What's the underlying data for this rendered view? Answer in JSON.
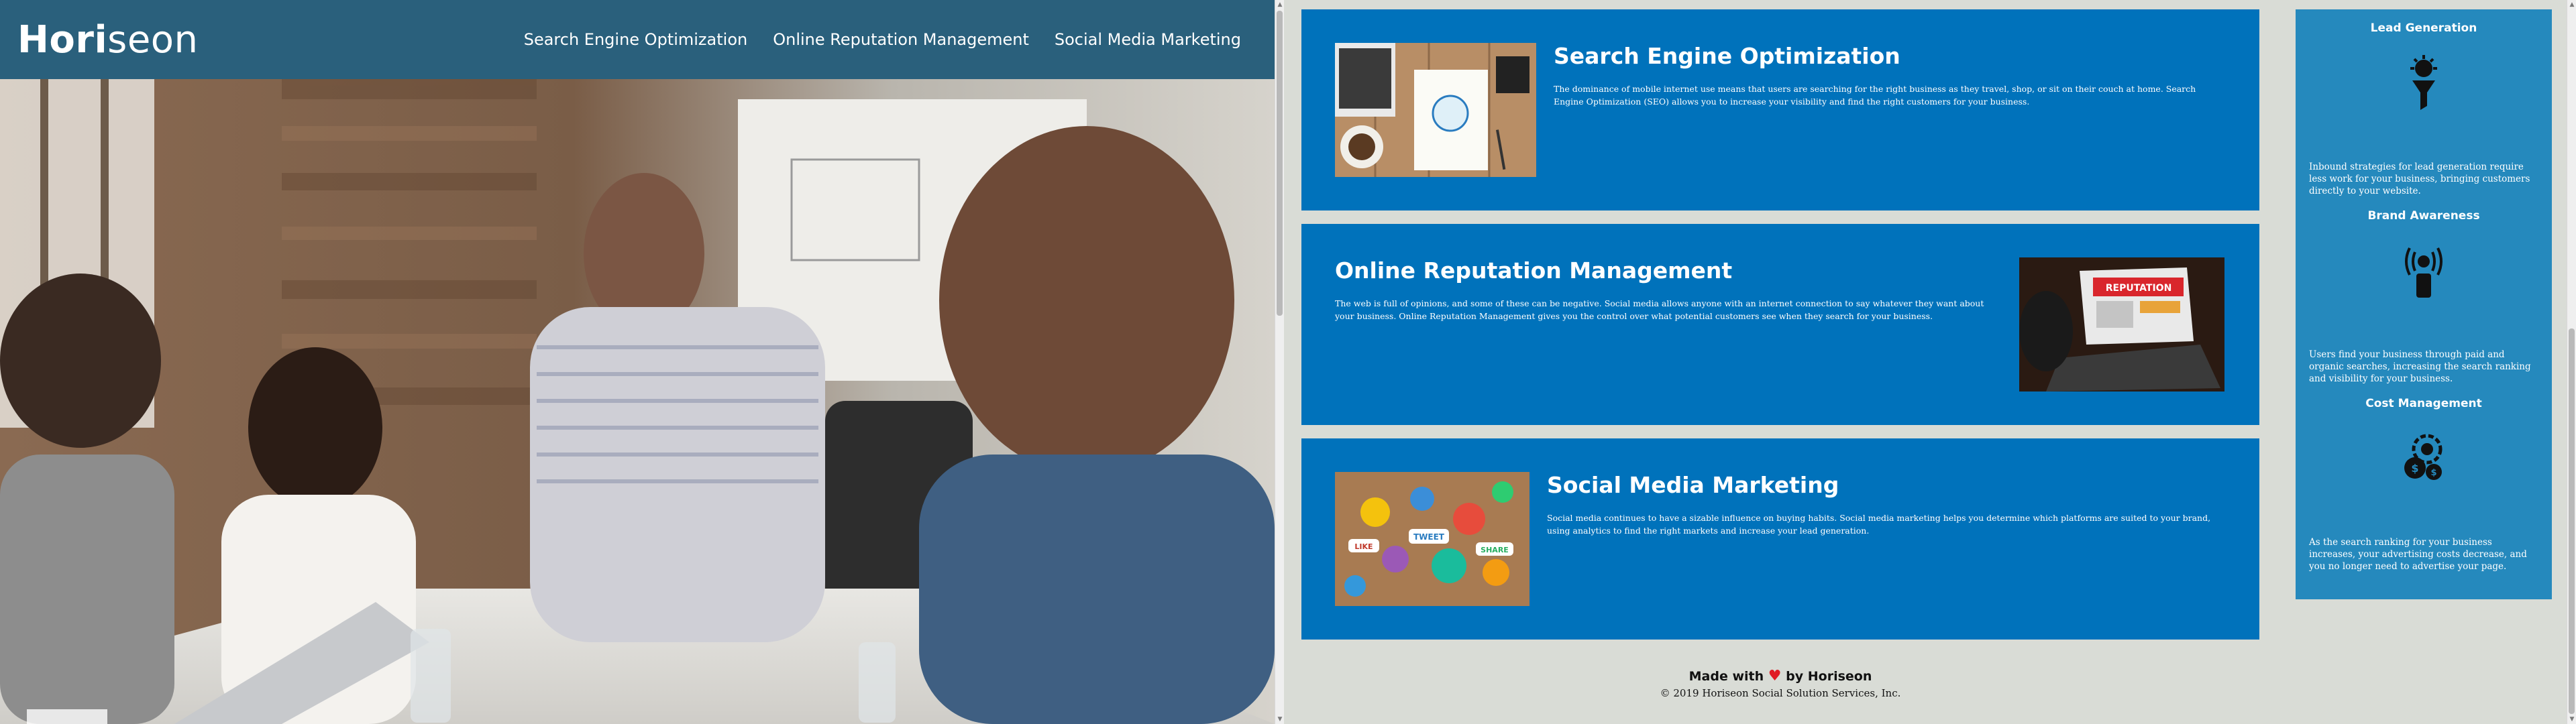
{
  "header": {
    "logo_main": "Hori",
    "logo_accent": "seon",
    "nav": [
      {
        "label": "Search Engine Optimization"
      },
      {
        "label": "Online Reputation Management"
      },
      {
        "label": "Social Media Marketing"
      }
    ]
  },
  "sections": [
    {
      "title": "Search Engine Optimization",
      "body": "The dominance of mobile internet use means that users are searching for the right business as they travel, shop, or sit on their couch at home. Search Engine Optimization (SEO) allows you to increase your visibility and find the right customers for your business.",
      "image_icon": "seo-workspace-image"
    },
    {
      "title": "Online Reputation Management",
      "body": "The web is full of opinions, and some of these can be negative. Social media allows anyone with an internet connection to say whatever they want about your business. Online Reputation Management gives you the control over what potential customers see when they search for your business.",
      "image_icon": "reputation-laptop-image",
      "image_text": "REPUTATION"
    },
    {
      "title": "Social Media Marketing",
      "body": "Social media continues to have a sizable influence on buying habits. Social media marketing helps you determine which platforms are suited to your brand, using analytics to find the right markets and increase your lead generation.",
      "image_icon": "social-media-collage-image",
      "image_labels": [
        "TWEET",
        "LIKE",
        "SHARE"
      ]
    }
  ],
  "benefits": [
    {
      "title": "Lead Generation",
      "body": "Inbound strategies for lead generation require less work for your business, bringing customers directly to your website.",
      "icon": "lead-generation-icon"
    },
    {
      "title": "Brand Awareness",
      "body": "Users find your business through paid and organic searches, increasing the search ranking and visibility for your business.",
      "icon": "brand-awareness-icon"
    },
    {
      "title": "Cost Management",
      "body": "As the search ranking for your business increases, your advertising costs decrease, and you no longer need to advertise your page.",
      "icon": "cost-management-icon"
    }
  ],
  "footer": {
    "made_with": "Made with",
    "by": "by Horiseon",
    "copyright": "© 2019 Horiseon Social Solution Services, Inc."
  },
  "colors": {
    "header": "#2a607c",
    "card": "#0072bb",
    "sidebar": "#2589bd",
    "heart": "#e01b24",
    "page_bg": "#d9dcd6"
  }
}
